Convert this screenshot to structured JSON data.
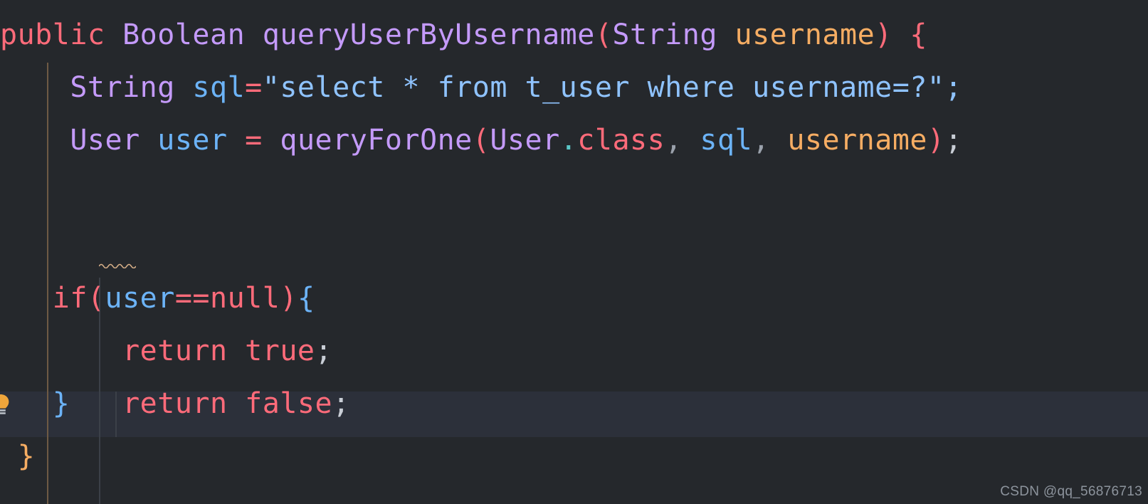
{
  "editor": {
    "background_color": "#25282c",
    "current_line_color": "#2c303a",
    "language": "Java"
  },
  "gutter": {
    "lightbulb_icon": "lightbulb-icon",
    "lightbulb_color": "#efa53b"
  },
  "indent_guides": [
    {
      "name": "indent-guide-level-1",
      "color": "#6e5a44"
    },
    {
      "name": "indent-guide-level-2",
      "color": "#3b4048"
    },
    {
      "name": "indent-guide-level-3",
      "color": "#3b4048"
    }
  ],
  "code": {
    "line1": {
      "t1": "public",
      "t2": " ",
      "t3": "Boolean",
      "t4": " ",
      "t5": "queryUserByUsername",
      "t6": "(",
      "t7": "String",
      "t8": " ",
      "t9": "username",
      "t10": ")",
      "t11": " ",
      "t12": "{"
    },
    "line2": {
      "indent": "    ",
      "t1": "String",
      "t2": " ",
      "t3": "sql",
      "t4": "=",
      "t5": "\"select * from t_user where username=?\"",
      "t6": ";"
    },
    "line3": {
      "indent": "    ",
      "t1": "User",
      "t2": " ",
      "t3": "user",
      "t4": " ",
      "t5": "=",
      "t6": " ",
      "t7": "queryForOne",
      "t8": "(",
      "t9": "User",
      "t10": ".",
      "t11": "class",
      "t12": ",",
      "t13": " ",
      "t14": "sql",
      "t15": ",",
      "t16": " ",
      "t17": "username",
      "t18": ")",
      "t19": ";"
    },
    "line4": {
      "text": ""
    },
    "line5": {
      "text": ""
    },
    "line6": {
      "indent": "   ",
      "t1": "if",
      "t2": "(",
      "t3": "user",
      "t4": "==",
      "t5": "null",
      "t6": ")",
      "t7": "{"
    },
    "line7": {
      "indent": "       ",
      "t1": "return",
      "t2": " ",
      "t3": "true",
      "t4": ";"
    },
    "line8": {
      "indent": "   ",
      "t1": "}"
    },
    "line9": {
      "indent": "       ",
      "t1": "return",
      "t2": " ",
      "t3": "false",
      "t4": ";"
    },
    "line10": {
      "indent": " ",
      "t1": "}"
    }
  },
  "colors": {
    "keyword": "#ff6b7a",
    "type": "#c49afa",
    "parameter": "#f6ad63",
    "variable": "#6cb3f7",
    "string": "#8fc3ff",
    "brace_blue": "#6cb3f7",
    "brace_orange": "#f6ad63",
    "semicolon": "#c9ced6",
    "squiggle": "#d8b089"
  },
  "watermark": {
    "text": "CSDN @qq_56876713"
  }
}
